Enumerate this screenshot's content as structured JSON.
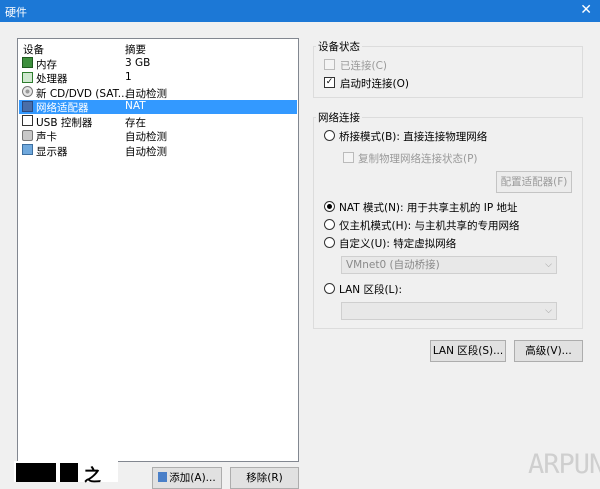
{
  "window": {
    "title": "硬件",
    "close_glyph": "✕"
  },
  "device_list": {
    "headers": {
      "device": "设备",
      "summary": "摘要"
    },
    "rows": [
      {
        "name": "内存",
        "summary": "3 GB",
        "icon": "memory-icon"
      },
      {
        "name": "处理器",
        "summary": "1",
        "icon": "cpu-icon"
      },
      {
        "name": "新 CD/DVD (SAT...",
        "summary": "自动检测",
        "icon": "cd-dvd-icon"
      },
      {
        "name": "网络适配器",
        "summary": "NAT",
        "icon": "network-adapter-icon",
        "selected": true
      },
      {
        "name": "USB 控制器",
        "summary": "存在",
        "icon": "usb-icon"
      },
      {
        "name": "声卡",
        "summary": "自动检测",
        "icon": "sound-card-icon"
      },
      {
        "name": "显示器",
        "summary": "自动检测",
        "icon": "display-icon"
      }
    ]
  },
  "buttons": {
    "add": "添加(A)...",
    "remove": "移除(R)"
  },
  "device_status": {
    "label": "设备状态",
    "connected": {
      "label": "已连接(C)",
      "checked": false,
      "enabled": false
    },
    "connect_at_power_on": {
      "label": "启动时连接(O)",
      "checked": true,
      "check_glyph": "✓"
    }
  },
  "network_connection": {
    "label": "网络连接",
    "bridged": {
      "label": "桥接模式(B): 直接连接物理网络",
      "selected": false
    },
    "replicate": {
      "label": "复制物理网络连接状态(P)",
      "checked": false,
      "enabled": false
    },
    "configure_adapters": "配置适配器(F)",
    "nat": {
      "label": "NAT 模式(N): 用于共享主机的 IP 地址",
      "selected": true
    },
    "host_only": {
      "label": "仅主机模式(H): 与主机共享的专用网络",
      "selected": false
    },
    "custom": {
      "label": "自定义(U): 特定虚拟网络",
      "selected": false
    },
    "vmnet_select": "VMnet0 (自动桥接)",
    "lan_segment": {
      "label": "LAN 区段(L):",
      "selected": false
    },
    "lan_select": ""
  },
  "bottom_buttons": {
    "lan_segments": "LAN 区段(S)...",
    "advanced": "高级(V)..."
  },
  "dropdown_arrow": "⌵",
  "branding": {
    "logo_text": "IT之家",
    "logo_glyph": "之",
    "watermark": "ARPUN"
  }
}
